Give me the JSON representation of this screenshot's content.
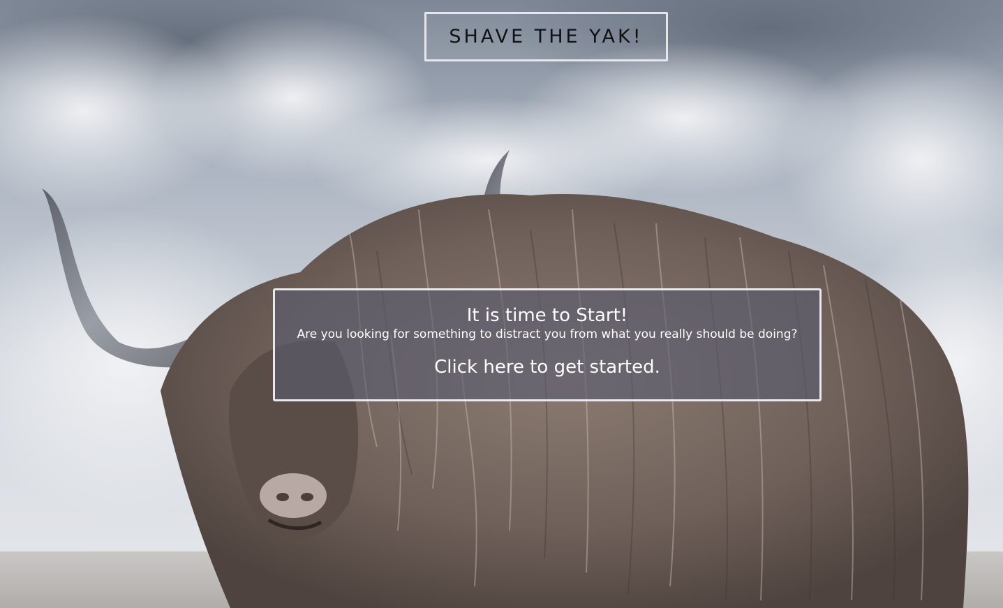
{
  "header": {
    "title": "SHAVE THE YAK!"
  },
  "hero": {
    "background": "highland-yak-photo",
    "heading": "It is time to Start!",
    "subheading": "Are you looking for something to distract you from what you really should be doing?",
    "cta_label": "Click here to get started."
  },
  "colors": {
    "panel_overlay": "#585c70",
    "border": "#ebecf0",
    "title_text": "#111111",
    "panel_text": "#ffffff"
  }
}
